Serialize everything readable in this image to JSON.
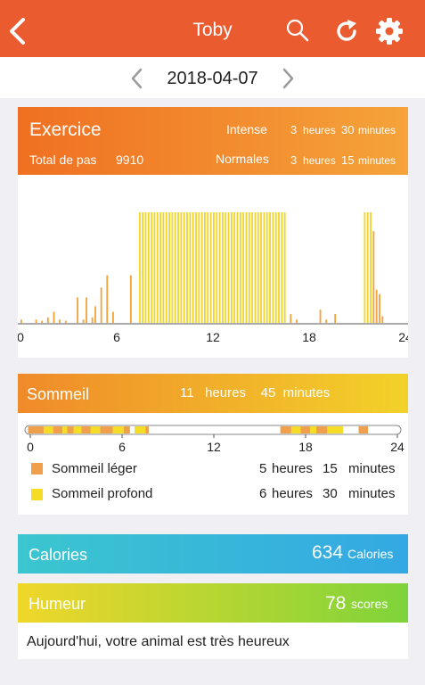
{
  "nav": {
    "title": "Toby",
    "back_icon": "chevron-left-icon",
    "search_icon": "search-icon",
    "refresh_icon": "refresh-icon",
    "settings_icon": "gear-icon",
    "color": "#ea5b2f"
  },
  "date": {
    "value": "2018-04-07"
  },
  "exercise": {
    "title": "Exercice",
    "steps_label": "Total de pas",
    "steps_value": "9910",
    "intense": {
      "label": "Intense",
      "hours": "3",
      "hours_unit": "heures",
      "minutes": "30",
      "minutes_unit": "minutes"
    },
    "normal": {
      "label": "Normales",
      "hours": "3",
      "hours_unit": "heures",
      "minutes": "15",
      "minutes_unit": "minutes"
    }
  },
  "chart_data": {
    "type": "bar",
    "xlim": [
      0,
      24
    ],
    "ylim": [
      0,
      1
    ],
    "xticks": [
      "0",
      "6",
      "12",
      "18",
      "24"
    ],
    "bar_color": "#f4a23c",
    "peak_color": "#f2d42a",
    "values": [
      0.03,
      0,
      0,
      0,
      0,
      0.03,
      0,
      0.02,
      0,
      0.05,
      0,
      0.1,
      0,
      0.03,
      0,
      0.02,
      0,
      0,
      0,
      0.23,
      0,
      0.03,
      0.23,
      0,
      0.05,
      0.15,
      0,
      0.32,
      0,
      0.43,
      0,
      0.1,
      0,
      0,
      0,
      0,
      0,
      0.43,
      0,
      0,
      1,
      1,
      1,
      1,
      1,
      1,
      1,
      1,
      1,
      1,
      1,
      1,
      1,
      1,
      1,
      1,
      1,
      1,
      1,
      1,
      1,
      1,
      1,
      1,
      1,
      1,
      1,
      1,
      1,
      1,
      1,
      1,
      1,
      1,
      1,
      1,
      1,
      1,
      1,
      1,
      1,
      1,
      1,
      1,
      1,
      1,
      1,
      1,
      1,
      1,
      0,
      0.08,
      0,
      0.03,
      0,
      0,
      0,
      0,
      0,
      0,
      0,
      0.12,
      0,
      0.03,
      0,
      0,
      0.08,
      0,
      0,
      0,
      0,
      0,
      0,
      0,
      0,
      0,
      1,
      1,
      1,
      0.83,
      0.3,
      0.26,
      0.06,
      0,
      0,
      0,
      0,
      0,
      0,
      0
    ]
  },
  "sleep": {
    "title": "Sommeil",
    "total_hours": "11",
    "hours_unit": "heures",
    "total_minutes": "45",
    "minutes_unit": "minutes",
    "ticks": [
      "0",
      "6",
      "12",
      "18",
      "24"
    ],
    "light_color": "#f0a04a",
    "deep_color": "#f5dc27",
    "segments": [
      {
        "start": 0.2,
        "end": 1.2,
        "kind": "light"
      },
      {
        "start": 1.2,
        "end": 1.8,
        "kind": "deep"
      },
      {
        "start": 1.8,
        "end": 2.4,
        "kind": "light"
      },
      {
        "start": 2.4,
        "end": 2.7,
        "kind": "deep"
      },
      {
        "start": 2.7,
        "end": 3.1,
        "kind": "light"
      },
      {
        "start": 3.1,
        "end": 3.6,
        "kind": "deep"
      },
      {
        "start": 3.6,
        "end": 4.2,
        "kind": "light"
      },
      {
        "start": 4.2,
        "end": 4.8,
        "kind": "deep"
      },
      {
        "start": 4.8,
        "end": 5.6,
        "kind": "light"
      },
      {
        "start": 5.6,
        "end": 6.3,
        "kind": "deep"
      },
      {
        "start": 6.3,
        "end": 6.7,
        "kind": "light"
      },
      {
        "start": 7.0,
        "end": 7.7,
        "kind": "deep"
      },
      {
        "start": 7.7,
        "end": 7.9,
        "kind": "light"
      },
      {
        "start": 16.3,
        "end": 17.0,
        "kind": "light"
      },
      {
        "start": 17.0,
        "end": 17.6,
        "kind": "deep"
      },
      {
        "start": 17.6,
        "end": 18.2,
        "kind": "light"
      },
      {
        "start": 18.2,
        "end": 18.6,
        "kind": "deep"
      },
      {
        "start": 18.6,
        "end": 19.3,
        "kind": "light"
      },
      {
        "start": 19.3,
        "end": 20.3,
        "kind": "deep"
      },
      {
        "start": 21.3,
        "end": 21.9,
        "kind": "light"
      }
    ],
    "light": {
      "label": "Sommeil léger",
      "hours": "5",
      "hours_unit": "heures",
      "minutes": "15",
      "minutes_unit": "minutes"
    },
    "deep": {
      "label": "Sommeil profond",
      "hours": "6",
      "hours_unit": "heures",
      "minutes": "30",
      "minutes_unit": "minutes"
    }
  },
  "calories": {
    "title": "Calories",
    "value": "634",
    "unit": "Calories"
  },
  "mood": {
    "title": "Humeur",
    "value": "78",
    "unit": "scores",
    "message": "Aujourd'hui, votre animal est très heureux"
  }
}
